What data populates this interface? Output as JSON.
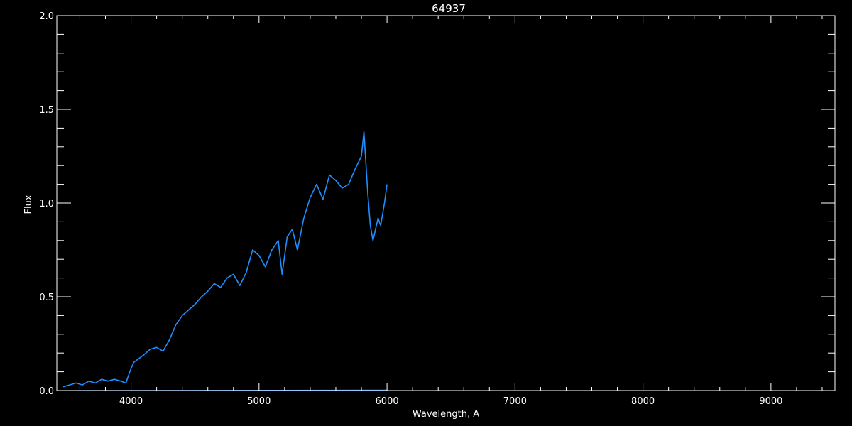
{
  "chart_data": {
    "type": "line",
    "title": "64937",
    "xlabel": "Wavelength, A",
    "ylabel": "Flux",
    "xlim": [
      3420,
      9500
    ],
    "ylim": [
      0.0,
      2.0
    ],
    "x_ticks": [
      4000,
      5000,
      6000,
      7000,
      8000,
      9000
    ],
    "y_ticks": [
      0.0,
      0.5,
      1.0,
      1.5,
      2.0
    ],
    "y_tick_labels": [
      "0.0",
      "0.5",
      "1.0",
      "1.5",
      "2.0"
    ],
    "grid": false,
    "legend": "none",
    "colors": {
      "background": "#000000",
      "axes": "#ffffff",
      "spectrum": "#1e8fff"
    },
    "series": [
      {
        "style": "spectrum",
        "x": [
          3470,
          3520,
          3570,
          3620,
          3670,
          3720,
          3770,
          3820,
          3870,
          3920,
          3960,
          3990,
          4020,
          4060,
          4100,
          4150,
          4200,
          4250,
          4300,
          4350,
          4400,
          4450,
          4500,
          4550,
          4600,
          4650,
          4700,
          4750,
          4800,
          4850,
          4900,
          4950,
          5000,
          5050,
          5100,
          5150,
          5180,
          5220,
          5260,
          5300,
          5350,
          5400,
          5450,
          5500,
          5550,
          5600,
          5650,
          5700,
          5750,
          5800,
          5820,
          5850,
          5870,
          5890,
          5910,
          5930,
          5950,
          5980,
          6000
        ],
        "y": [
          0.02,
          0.03,
          0.04,
          0.03,
          0.05,
          0.04,
          0.06,
          0.05,
          0.06,
          0.05,
          0.04,
          0.1,
          0.15,
          0.17,
          0.19,
          0.22,
          0.23,
          0.21,
          0.27,
          0.35,
          0.4,
          0.43,
          0.46,
          0.5,
          0.53,
          0.57,
          0.55,
          0.6,
          0.62,
          0.56,
          0.63,
          0.75,
          0.72,
          0.66,
          0.75,
          0.8,
          0.62,
          0.82,
          0.86,
          0.75,
          0.92,
          1.03,
          1.1,
          1.02,
          1.15,
          1.12,
          1.08,
          1.1,
          1.18,
          1.25,
          1.38,
          1.05,
          0.88,
          0.8,
          0.86,
          0.92,
          0.88,
          1.0,
          1.1
        ]
      },
      {
        "style": "baseline",
        "x": [
          3420,
          6000
        ],
        "y": [
          0.0,
          0.003
        ]
      }
    ]
  }
}
